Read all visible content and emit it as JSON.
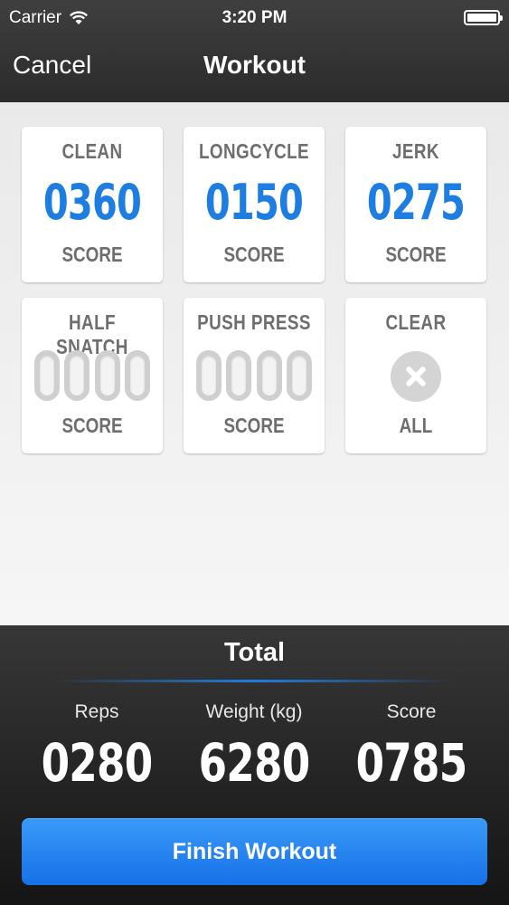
{
  "status_bar": {
    "carrier": "Carrier",
    "time": "3:20 PM",
    "wifi_icon": "wifi-icon",
    "battery_icon": "battery-icon"
  },
  "nav": {
    "cancel_label": "Cancel",
    "title": "Workout"
  },
  "cards": [
    {
      "label": "CLEAN",
      "value": "0360",
      "footer": "SCORE"
    },
    {
      "label": "LONGCYCLE",
      "value": "0150",
      "footer": "SCORE"
    },
    {
      "label": "JERK",
      "value": "0275",
      "footer": "SCORE"
    },
    {
      "label": "HALF SNATCH",
      "value": "",
      "footer": "SCORE"
    },
    {
      "label": "PUSH PRESS",
      "value": "",
      "footer": "SCORE"
    },
    {
      "label": "CLEAR",
      "icon": "close-icon",
      "footer": "ALL"
    }
  ],
  "totals": {
    "title": "Total",
    "reps_label": "Reps",
    "reps_value": "0280",
    "weight_label": "Weight (kg)",
    "weight_value": "6280",
    "score_label": "Score",
    "score_value": "0785"
  },
  "finish_label": "Finish Workout",
  "colors": {
    "accent": "#1e7de0",
    "nav_bg": "#333333",
    "button": "#1e80f0"
  }
}
